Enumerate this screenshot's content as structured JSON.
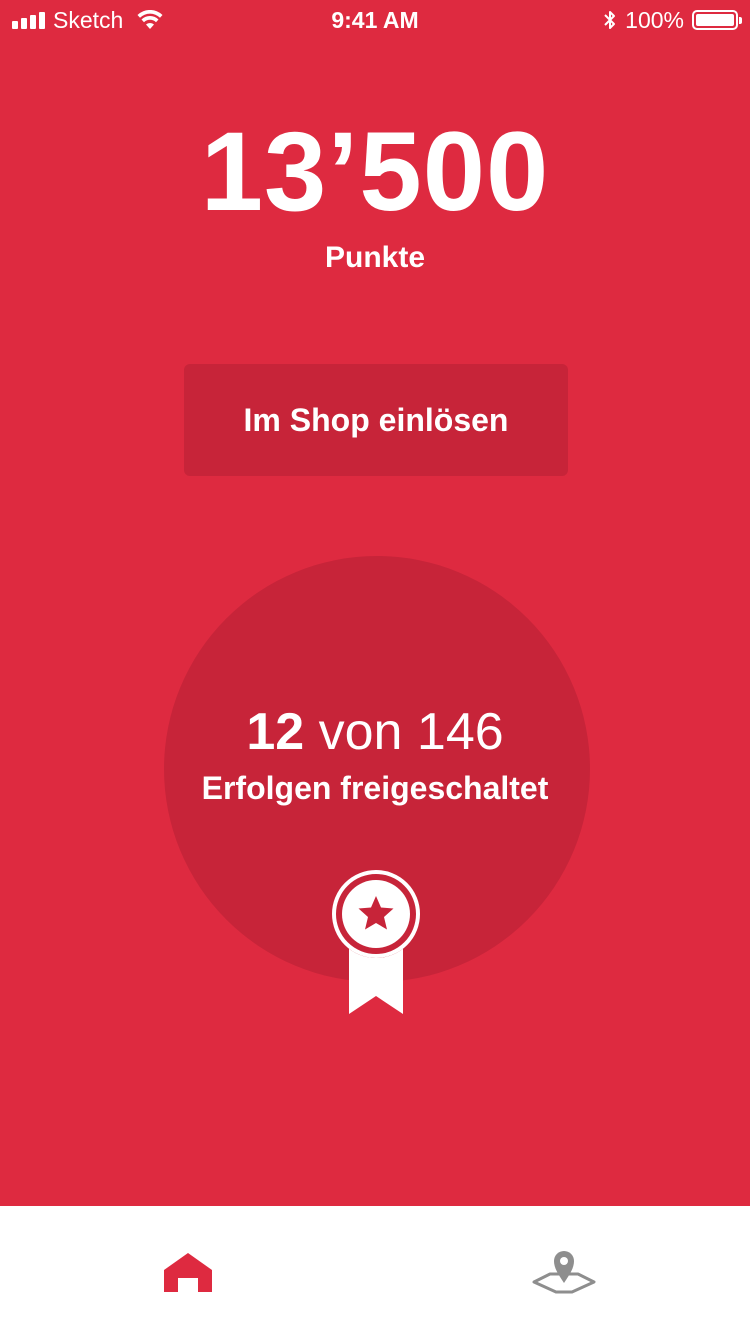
{
  "status_bar": {
    "carrier": "Sketch",
    "time": "9:41 AM",
    "battery_text": "100%",
    "battery_level": 1.0
  },
  "points": {
    "value": "13’500",
    "label": "Punkte"
  },
  "shop_button": {
    "label": "Im Shop einlösen"
  },
  "achievements": {
    "unlocked": "12",
    "of_total": "von 146",
    "label": "Erfolgen freigeschaltet",
    "icon": "award-ribbon-icon"
  },
  "tab_bar": {
    "tabs": [
      {
        "icon": "home-icon",
        "active": true
      },
      {
        "icon": "map-pin-icon",
        "active": false
      }
    ]
  },
  "colors": {
    "background": "#DE2A40",
    "surface_dark": "#C72439",
    "active_tab": "#DE2A40",
    "inactive_tab": "#8E8E8E",
    "tab_bar_bg": "#FFFFFF"
  }
}
